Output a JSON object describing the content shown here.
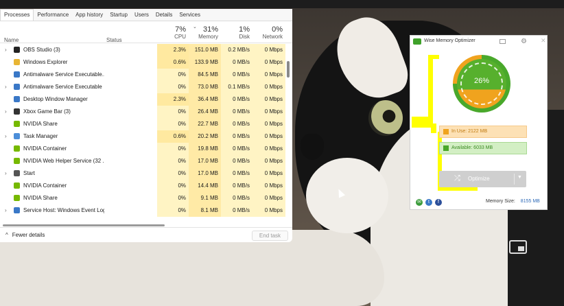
{
  "taskmanager": {
    "tabs": [
      "Processes",
      "Performance",
      "App history",
      "Startup",
      "Users",
      "Details",
      "Services"
    ],
    "columns": {
      "name": "Name",
      "status": "Status",
      "cpu": {
        "pct": "7%",
        "label": "CPU"
      },
      "memory": {
        "pct": "31%",
        "label": "Memory"
      },
      "disk": {
        "pct": "1%",
        "label": "Disk"
      },
      "network": {
        "pct": "0%",
        "label": "Network"
      }
    },
    "rows": [
      {
        "expand": true,
        "name": "OBS Studio (3)",
        "icon": "obs-icon",
        "color": "#222222",
        "cpu": "2.3%",
        "memory": "151.0 MB",
        "disk": "0.2 MB/s",
        "network": "0 Mbps"
      },
      {
        "expand": false,
        "name": "Windows Explorer",
        "icon": "folder-icon",
        "color": "#e8b534",
        "cpu": "0.6%",
        "memory": "133.9 MB",
        "disk": "0 MB/s",
        "network": "0 Mbps"
      },
      {
        "expand": false,
        "name": "Antimalware Service Executable...",
        "icon": "defender-icon",
        "color": "#3a78c7",
        "cpu": "0%",
        "memory": "84.5 MB",
        "disk": "0 MB/s",
        "network": "0 Mbps"
      },
      {
        "expand": true,
        "name": "Antimalware Service Executable",
        "icon": "defender-icon",
        "color": "#3a78c7",
        "cpu": "0%",
        "memory": "73.0 MB",
        "disk": "0.1 MB/s",
        "network": "0 Mbps"
      },
      {
        "expand": false,
        "name": "Desktop Window Manager",
        "icon": "dwm-icon",
        "color": "#3a78c7",
        "cpu": "2.3%",
        "memory": "36.4 MB",
        "disk": "0 MB/s",
        "network": "0 Mbps"
      },
      {
        "expand": true,
        "name": "Xbox Game Bar (3)",
        "icon": "xbox-icon",
        "color": "#333333",
        "cpu": "0%",
        "memory": "26.4 MB",
        "disk": "0 MB/s",
        "network": "0 Mbps"
      },
      {
        "expand": false,
        "name": "NVIDIA Share",
        "icon": "nvidia-icon",
        "color": "#76b900",
        "cpu": "0%",
        "memory": "22.7 MB",
        "disk": "0 MB/s",
        "network": "0 Mbps"
      },
      {
        "expand": true,
        "name": "Task Manager",
        "icon": "taskmanager-icon",
        "color": "#4c8ed9",
        "cpu": "0.6%",
        "memory": "20.2 MB",
        "disk": "0 MB/s",
        "network": "0 Mbps"
      },
      {
        "expand": false,
        "name": "NVIDIA Container",
        "icon": "nvidia-icon",
        "color": "#76b900",
        "cpu": "0%",
        "memory": "19.8 MB",
        "disk": "0 MB/s",
        "network": "0 Mbps"
      },
      {
        "expand": false,
        "name": "NVIDIA Web Helper Service (32 ...",
        "icon": "nvidia-icon",
        "color": "#76b900",
        "cpu": "0%",
        "memory": "17.0 MB",
        "disk": "0 MB/s",
        "network": "0 Mbps"
      },
      {
        "expand": true,
        "name": "Start",
        "icon": "start-icon",
        "color": "#555555",
        "cpu": "0%",
        "memory": "17.0 MB",
        "disk": "0 MB/s",
        "network": "0 Mbps"
      },
      {
        "expand": false,
        "name": "NVIDIA Container",
        "icon": "nvidia-icon",
        "color": "#76b900",
        "cpu": "0%",
        "memory": "14.4 MB",
        "disk": "0 MB/s",
        "network": "0 Mbps"
      },
      {
        "expand": false,
        "name": "NVIDIA Share",
        "icon": "nvidia-icon",
        "color": "#76b900",
        "cpu": "0%",
        "memory": "9.1 MB",
        "disk": "0 MB/s",
        "network": "0 Mbps"
      },
      {
        "expand": true,
        "name": "Service Host: Windows Event Log",
        "icon": "service-icon",
        "color": "#3a78c7",
        "cpu": "0%",
        "memory": "8.1 MB",
        "disk": "0 MB/s",
        "network": "0 Mbps"
      }
    ],
    "footer": {
      "fewer_details": "Fewer details",
      "end_task": "End task"
    }
  },
  "wmo": {
    "title": "Wise Memory Optimizer",
    "gauge_percent": "26%",
    "gauge_fraction": 0.26,
    "in_use": "In Use: 2122 MB",
    "available": "Available: 6033 MB",
    "optimize": "Optimize",
    "memory_size_label": "Memory Size:",
    "memory_size_value": "8155 MB",
    "colors": {
      "green": "#49a82b",
      "orange": "#f0a31e",
      "highlight": "#ffff00"
    }
  }
}
